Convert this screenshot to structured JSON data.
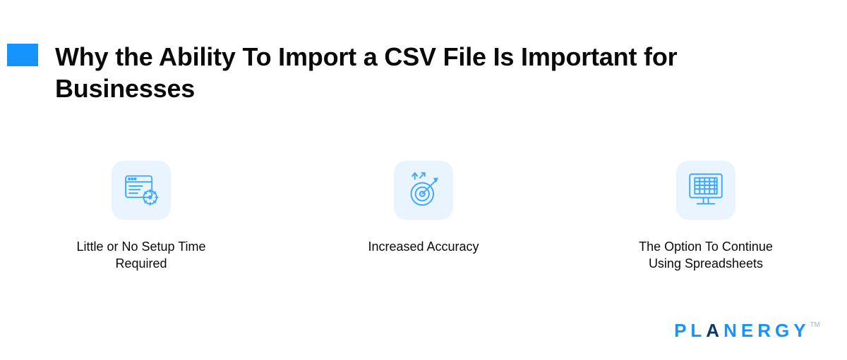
{
  "title": "Why the Ability To Import a CSV File Is Important for Businesses",
  "accent_color": "#1593ff",
  "features": [
    {
      "label": "Little or No Setup Time Required",
      "icon": "browser-setup-gear-icon"
    },
    {
      "label": "Increased Accuracy",
      "icon": "target-arrows-icon"
    },
    {
      "label": "The Option To Continue Using Spreadsheets",
      "icon": "spreadsheet-monitor-icon"
    }
  ],
  "brand": {
    "pre": "PL",
    "dark": "A",
    "post": "NERGY",
    "tm": "TM"
  }
}
